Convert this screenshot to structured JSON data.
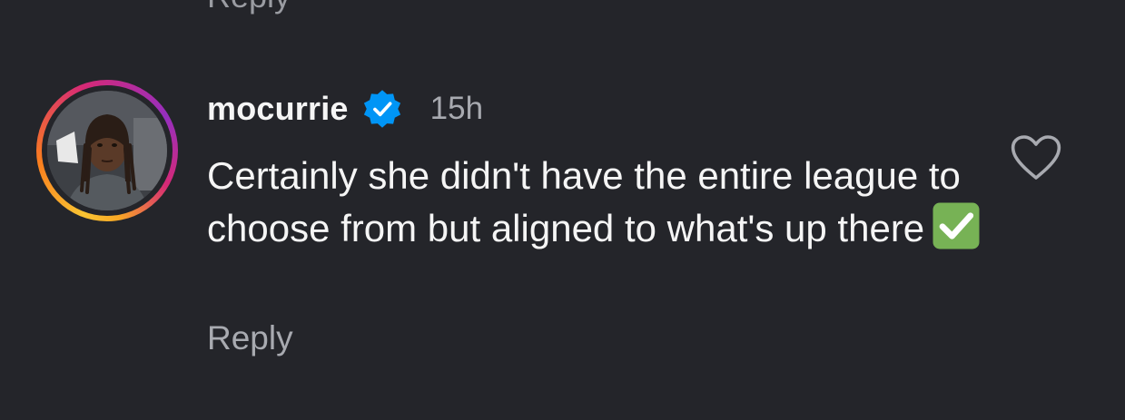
{
  "comment": {
    "username": "mocurrie",
    "timestamp": "15h",
    "text": "Certainly she didn't have the entire league to choose from but aligned to what's up there",
    "reply_label": "Reply",
    "is_verified": true,
    "emoji": "check-mark-button-emoji"
  },
  "previous_item": {
    "reply_label": "Reply"
  },
  "icons": {
    "verified": "verified-badge-icon",
    "like": "heart-outline-icon"
  },
  "colors": {
    "background": "#24252a",
    "text_primary": "#f5f5f5",
    "text_secondary": "#a8aab0",
    "verified_blue": "#0095f6",
    "check_green": "#77b255"
  }
}
